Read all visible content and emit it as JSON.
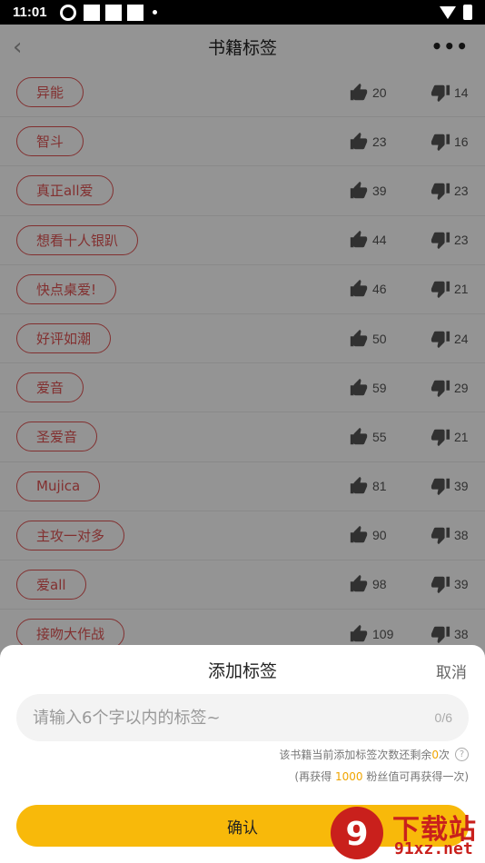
{
  "status_bar": {
    "time": "11:01"
  },
  "nav": {
    "back_label": "‹",
    "title": "书籍标签",
    "more_label": "•••"
  },
  "tags": [
    {
      "label": "异能",
      "likes": "20",
      "dislikes": "14"
    },
    {
      "label": "智斗",
      "likes": "23",
      "dislikes": "16"
    },
    {
      "label": "真正all爱",
      "likes": "39",
      "dislikes": "23"
    },
    {
      "label": "想看十人银趴",
      "likes": "44",
      "dislikes": "23"
    },
    {
      "label": "快点桌爱!",
      "likes": "46",
      "dislikes": "21"
    },
    {
      "label": "好评如潮",
      "likes": "50",
      "dislikes": "24"
    },
    {
      "label": "爱音",
      "likes": "59",
      "dislikes": "29"
    },
    {
      "label": "圣爱音",
      "likes": "55",
      "dislikes": "21"
    },
    {
      "label": "Mujica",
      "likes": "81",
      "dislikes": "39"
    },
    {
      "label": "主攻一对多",
      "likes": "90",
      "dislikes": "38"
    },
    {
      "label": "爱all",
      "likes": "98",
      "dislikes": "39"
    },
    {
      "label": "接吻大作战",
      "likes": "109",
      "dislikes": "38"
    }
  ],
  "sheet": {
    "title": "添加标签",
    "cancel_label": "取消",
    "input_placeholder": "请输入6个字以内的标签~",
    "input_value": "",
    "counter": "0/6",
    "hint1_prefix": "该书籍当前添加标签次数还剩余",
    "hint1_count": "0",
    "hint1_suffix": "次",
    "hint2_prefix": "(再获得",
    "hint2_count": "1000",
    "hint2_suffix": "粉丝值可再获得一次)",
    "confirm_label": "确认"
  },
  "watermark": {
    "brand": "下载站",
    "url": "91xz.net"
  },
  "colors": {
    "tag_red": "#e15454",
    "confirm_yellow": "#f8b90a",
    "highlight_orange": "#f0a500",
    "watermark_red": "#c9201c"
  },
  "icons": {
    "like": "thumbs-up-icon",
    "dislike": "thumbs-down-icon"
  }
}
